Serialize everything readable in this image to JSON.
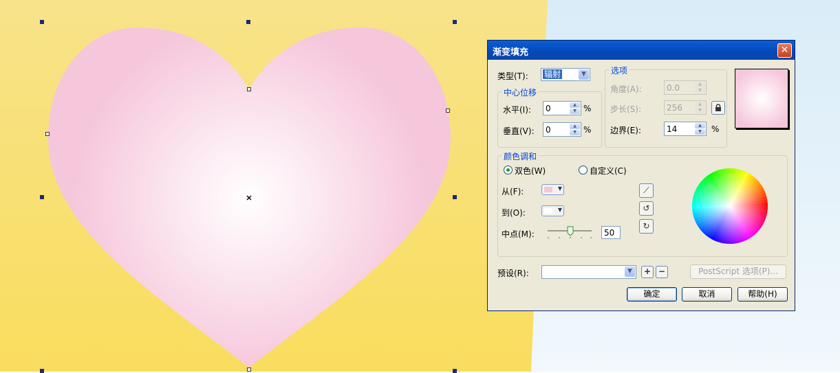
{
  "canvas": {
    "colors": {
      "yellow": "#f9e07a",
      "blue": "#deeef9",
      "heart_edge": "#f6c6db",
      "heart_center": "#ffffff",
      "handle": "#1a2a7a"
    }
  },
  "dialog": {
    "title": "渐变填充",
    "close_icon": "close-icon",
    "type": {
      "label": "类型(T):",
      "value": "辐射"
    },
    "center_offset": {
      "title": "中心位移",
      "horizontal_label": "水平(I):",
      "horizontal_value": "0",
      "vertical_label": "垂直(V):",
      "vertical_value": "0",
      "unit": "%"
    },
    "options": {
      "title": "选项",
      "angle_label": "角度(A):",
      "angle_value": "0.0",
      "steps_label": "步长(S):",
      "steps_value": "256",
      "edge_label": "边界(E):",
      "edge_value": "14",
      "unit": "%",
      "lock_icon": "lock-icon"
    },
    "preview": {
      "from_color": "#f6c6db",
      "to_color": "#ffffff"
    },
    "blend": {
      "title": "颜色调和",
      "two_color_label": "双色(W)",
      "custom_label": "自定义(C)",
      "selected": "two_color",
      "from_label": "从(F):",
      "from_color": "#f6c6db",
      "to_label": "到(O):",
      "to_color": "#ffffff",
      "midpoint_label": "中点(M):",
      "midpoint_value": "50"
    },
    "preset": {
      "label": "预设(R):",
      "value": ""
    },
    "postscript_label": "PostScript 选项(P)...",
    "ok_label": "确定",
    "cancel_label": "取消",
    "help_label": "帮助(H)"
  }
}
